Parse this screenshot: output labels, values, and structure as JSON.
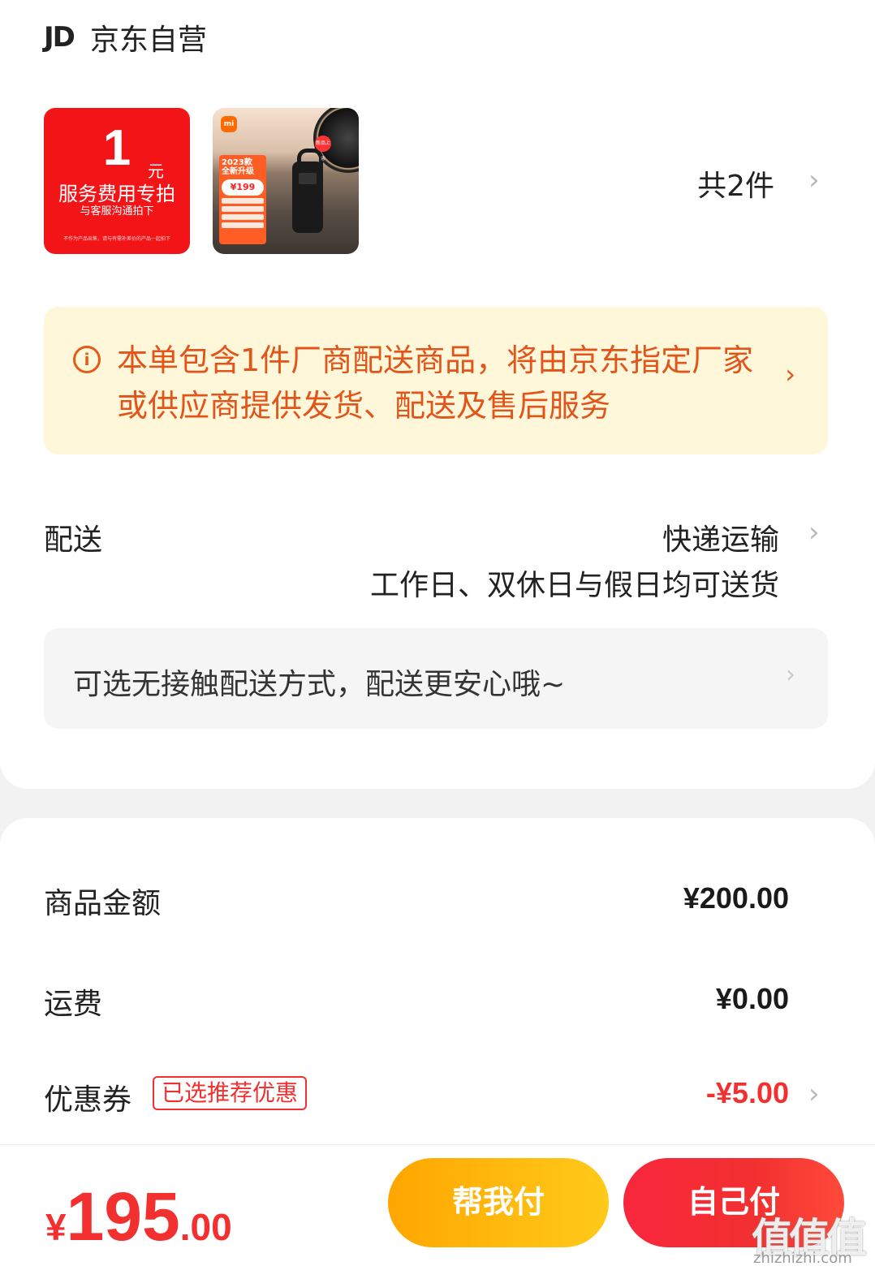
{
  "shop": {
    "logo": "JD",
    "name": "京东自营"
  },
  "items": {
    "service_fee": {
      "amount": "1",
      "unit": "元",
      "title": "服务费用专拍",
      "subtitle": "与客服沟通拍下",
      "fine_print": "不作为产品出售，请与有需补差价的产品一起拍下"
    },
    "product": {
      "brand_badge": "mi",
      "tag_year": "2023款",
      "tag_title": "全新升级",
      "price": "¥199",
      "new_badge": "新品上市"
    },
    "count": "共2件"
  },
  "notice": {
    "icon": "info-icon",
    "text": "本单包含1件厂商配送商品，将由京东指定厂家或供应商提供发货、配送及售后服务"
  },
  "delivery": {
    "label": "配送",
    "method": "快递运输",
    "days": "工作日、双休日与假日均可送货",
    "contactless_text": "可选无接触配送方式，配送更安心哦~"
  },
  "summary": {
    "goods_label": "商品金额",
    "goods_value": "¥200.00",
    "shipping_label": "运费",
    "shipping_value": "¥0.00",
    "coupon_label": "优惠券",
    "coupon_badge": "已选推荐优惠",
    "coupon_value": "-¥5.00"
  },
  "footer": {
    "total_yen": "¥",
    "total_int": "195",
    "total_dec": ".00",
    "help_pay_label": "帮我付",
    "self_pay_label": "自己付"
  },
  "watermark": {
    "text": "值值值",
    "url": "zhizhizhi.com"
  },
  "colors": {
    "accent_red": "#f23030",
    "notice_orange": "#e2541a",
    "notice_bg": "#fef7d9",
    "help_btn": "#ffb400"
  }
}
